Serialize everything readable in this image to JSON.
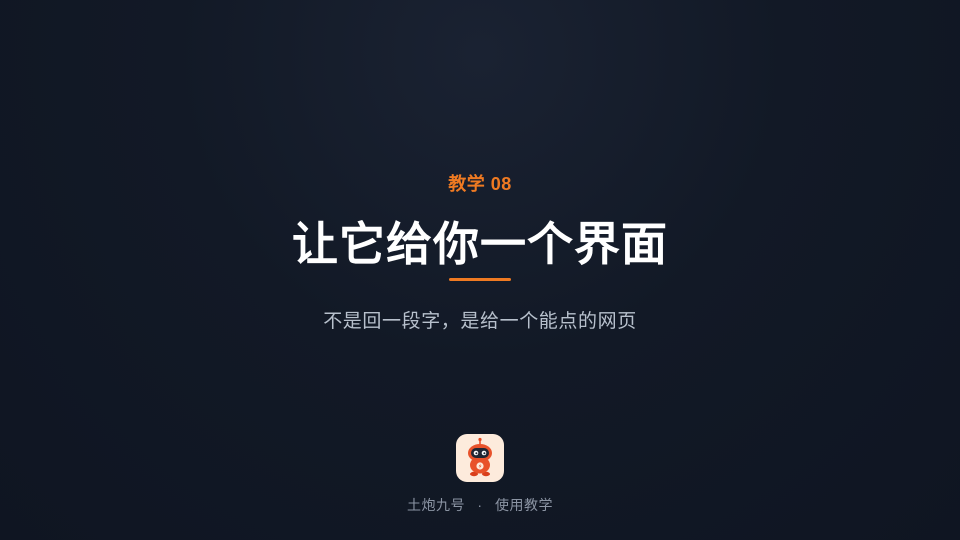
{
  "slide": {
    "eyebrow": "教学 08",
    "title": "让它给你一个界面",
    "subtitle": "不是回一段字，是给一个能点的网页",
    "footer": {
      "brand_name": "土炮九号",
      "separator": "·",
      "section": "使用教学"
    },
    "logo_icon": "robot-mascot-icon",
    "colors": {
      "background": "#121926",
      "accent": "#ef7a22",
      "title": "#ffffff",
      "subtitle": "#b7c0cc",
      "footer": "#8b94a3",
      "logo_bg": "#fdebdc"
    }
  }
}
